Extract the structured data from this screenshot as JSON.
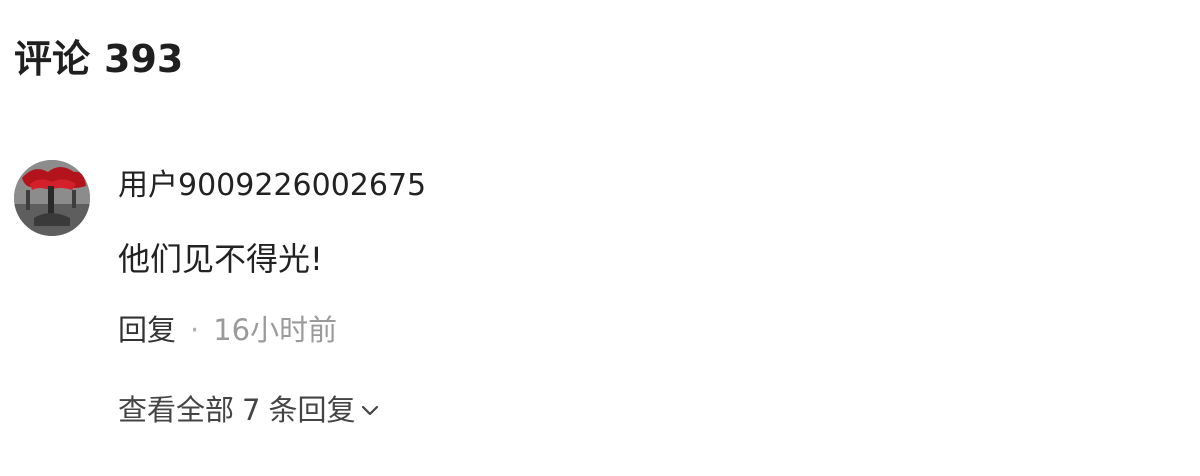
{
  "header": {
    "title": "评论",
    "count": "393"
  },
  "comment": {
    "username": "用户9009226002675",
    "content": "他们见不得光!",
    "reply_label": "回复",
    "separator": "·",
    "time": "16小时前",
    "view_replies_prefix": "查看全部",
    "view_replies_count": "7",
    "view_replies_suffix": "条回复",
    "chevron_icon": "chevron-down-icon"
  }
}
